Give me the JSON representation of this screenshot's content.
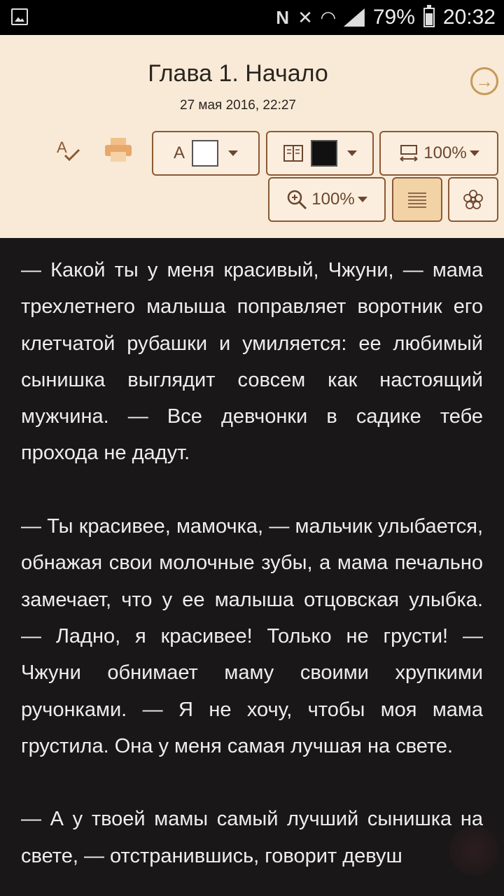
{
  "status_bar": {
    "battery": "79%",
    "time": "20:32",
    "icons": [
      "gallery-icon",
      "nfc-icon",
      "mute-icon",
      "wifi-icon",
      "signal-icon",
      "battery-icon"
    ]
  },
  "header": {
    "chapter_title": "Глава 1. Начало",
    "date": "27 мая 2016, 22:27",
    "font_color": "#ffffff",
    "bg_color": "#111111",
    "width_zoom": "100%",
    "text_zoom": "100%",
    "font_letter": "A"
  },
  "reader": {
    "paragraphs": [
      "— Какой ты у меня красивый, Чжуни, — мама трехлетнего малыша поправляет воротник его клетчатой рубашки и умиляется: ее любимый сынишка выглядит совсем как настоящий мужчина. — Все девчонки в садике тебе прохода не дадут.",
      "— Ты красивее, мамочка, — мальчик улыбается, обнажая свои молочные зубы, а мама печально замечает, что у ее малыша отцовская улыбка. — Ладно, я красивее! Только не грусти! — Чжуни обнимает маму своими хрупкими ручонками. — Я не хочу, чтобы моя мама грустила. Она у меня самая лучшая на свете.",
      "— А у твоей мамы самый лучший сынишка на свете, — отстранившись, говорит девуш"
    ]
  },
  "colors": {
    "header_bg": "#f9ead7",
    "reader_bg": "#1a1718",
    "accent": "#c59a5a",
    "border": "#8b5a35"
  }
}
